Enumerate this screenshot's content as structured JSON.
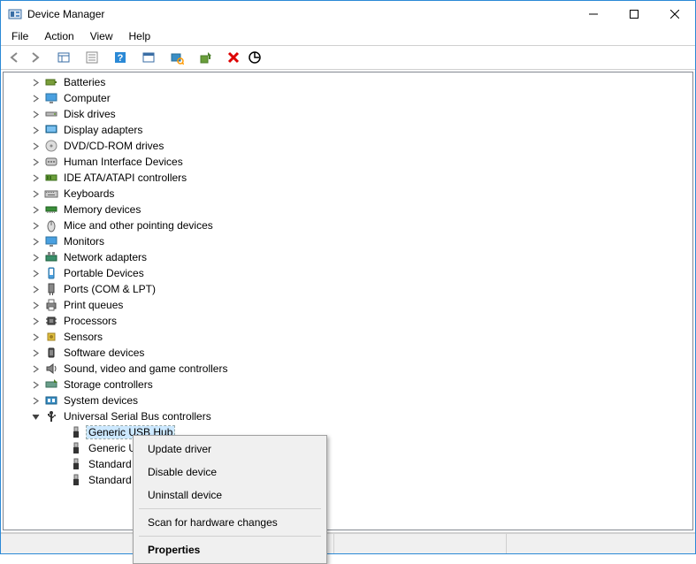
{
  "window": {
    "title": "Device Manager"
  },
  "menu": {
    "file": "File",
    "action": "Action",
    "view": "View",
    "help": "Help"
  },
  "tree": {
    "expanded_label": "Universal Serial Bus controllers",
    "items": [
      {
        "label": "Batteries",
        "icon": "battery"
      },
      {
        "label": "Computer",
        "icon": "monitor"
      },
      {
        "label": "Disk drives",
        "icon": "disk"
      },
      {
        "label": "Display adapters",
        "icon": "display"
      },
      {
        "label": "DVD/CD-ROM drives",
        "icon": "cd"
      },
      {
        "label": "Human Interface Devices",
        "icon": "hid"
      },
      {
        "label": "IDE ATA/ATAPI controllers",
        "icon": "ide"
      },
      {
        "label": "Keyboards",
        "icon": "keyboard"
      },
      {
        "label": "Memory devices",
        "icon": "memory"
      },
      {
        "label": "Mice and other pointing devices",
        "icon": "mouse"
      },
      {
        "label": "Monitors",
        "icon": "monitor"
      },
      {
        "label": "Network adapters",
        "icon": "network"
      },
      {
        "label": "Portable Devices",
        "icon": "portable"
      },
      {
        "label": "Ports (COM & LPT)",
        "icon": "port"
      },
      {
        "label": "Print queues",
        "icon": "printer"
      },
      {
        "label": "Processors",
        "icon": "cpu"
      },
      {
        "label": "Sensors",
        "icon": "sensor"
      },
      {
        "label": "Software devices",
        "icon": "software"
      },
      {
        "label": "Sound, video and game controllers",
        "icon": "sound"
      },
      {
        "label": "Storage controllers",
        "icon": "storage"
      },
      {
        "label": "System devices",
        "icon": "system"
      }
    ],
    "children": [
      {
        "label": "Generic USB Hub",
        "selected": true
      },
      {
        "label": "Generic U"
      },
      {
        "label": "Standard"
      },
      {
        "label": "Standard"
      }
    ]
  },
  "context_menu": {
    "update": "Update driver",
    "disable": "Disable device",
    "uninstall": "Uninstall device",
    "scan": "Scan for hardware changes",
    "properties": "Properties"
  }
}
